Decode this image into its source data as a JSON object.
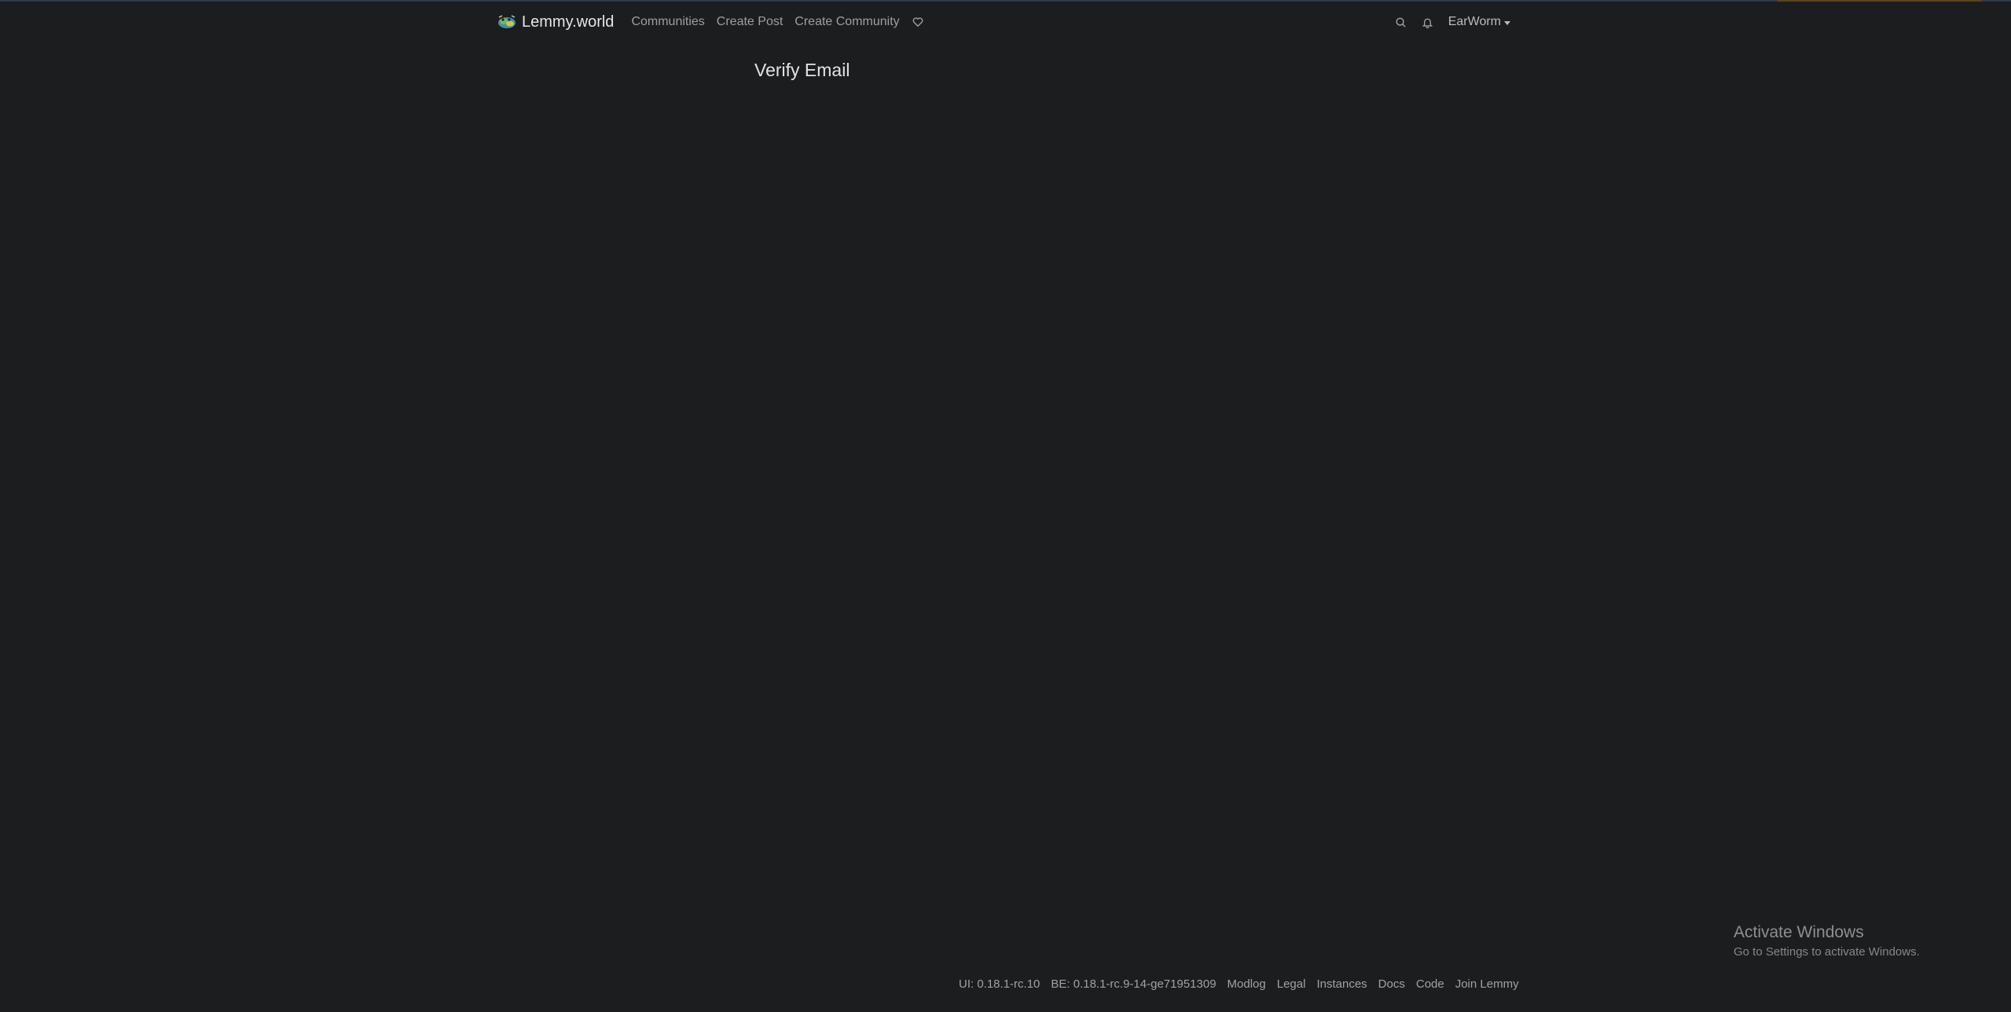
{
  "navbar": {
    "brand_name": "Lemmy.world",
    "links": {
      "communities": "Communities",
      "create_post": "Create Post",
      "create_community": "Create Community"
    },
    "user_name": "EarWorm"
  },
  "main": {
    "title": "Verify Email"
  },
  "footer": {
    "ui_version": "UI: 0.18.1-rc.10",
    "be_version": "BE: 0.18.1-rc.9-14-ge71951309",
    "modlog": "Modlog",
    "legal": "Legal",
    "instances": "Instances",
    "docs": "Docs",
    "code": "Code",
    "join": "Join Lemmy"
  },
  "watermark": {
    "title": "Activate Windows",
    "subtitle": "Go to Settings to activate Windows."
  },
  "colors": {
    "background": "#1c1d1f",
    "nav_text": "#9b9fa5",
    "title_text": "#e3e3e3"
  },
  "icons": [
    "lemmy-logo-icon",
    "heart-icon",
    "search-icon",
    "bell-icon",
    "caret-down-icon"
  ]
}
